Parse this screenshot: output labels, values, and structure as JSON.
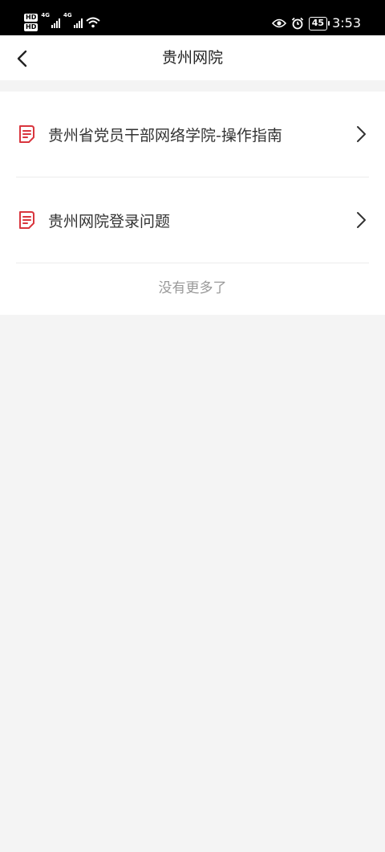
{
  "status_bar": {
    "hd1": "HD",
    "hd2": "HD",
    "net1": "4G",
    "net2": "4G",
    "battery": "45",
    "time": "3:53",
    "icons": [
      "wifi-icon",
      "eye-icon",
      "alarm-icon",
      "battery-icon"
    ]
  },
  "nav": {
    "title": "贵州网院",
    "back_icon": "chevron-left-icon"
  },
  "list": {
    "items": [
      {
        "label": "贵州省党员干部网络学院-操作指南",
        "icon": "document-icon"
      },
      {
        "label": "贵州网院登录问题",
        "icon": "document-icon"
      }
    ],
    "footer": "没有更多了"
  },
  "colors": {
    "accent": "#d9363e",
    "background": "#f4f4f4",
    "text": "#333333",
    "muted": "#999999"
  }
}
